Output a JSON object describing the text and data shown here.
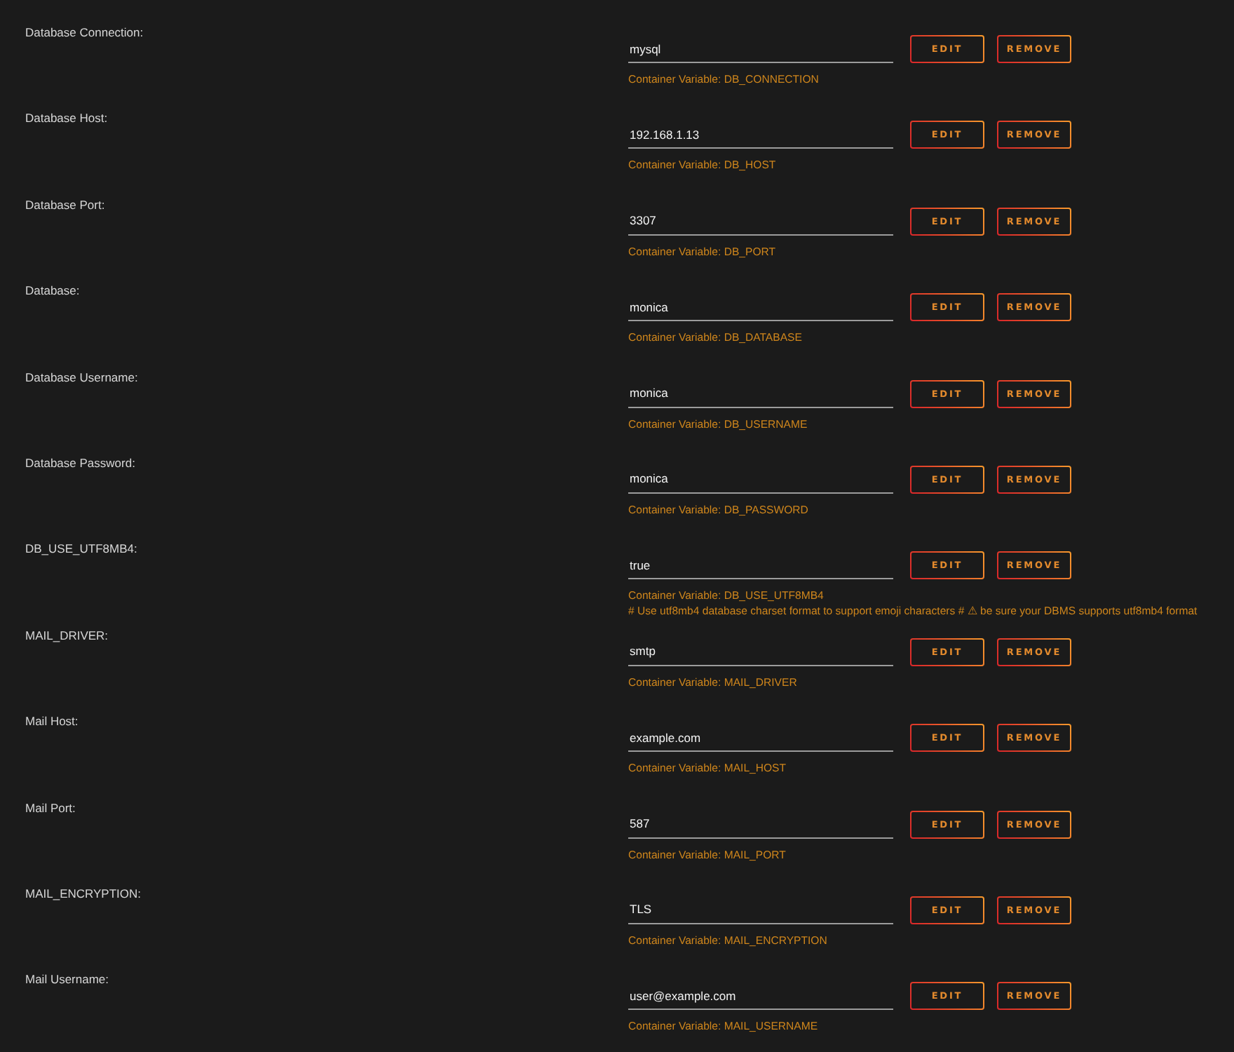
{
  "settings": [
    {
      "label": "Database Connection:",
      "value": "mysql",
      "variable": "Container Variable: DB_CONNECTION",
      "buttons": [
        "EDIT",
        "REMOVE"
      ]
    },
    {
      "label": "Database Host:",
      "value": "192.168.1.13",
      "variable": "Container Variable: DB_HOST",
      "buttons": [
        "EDIT",
        "REMOVE"
      ]
    },
    {
      "label": "Database Port:",
      "value": "3307",
      "variable": "Container Variable: DB_PORT",
      "buttons": [
        "EDIT",
        "REMOVE"
      ]
    },
    {
      "label": "Database:",
      "value": "monica",
      "variable": "Container Variable: DB_DATABASE",
      "buttons": [
        "EDIT",
        "REMOVE"
      ]
    },
    {
      "label": "Database Username:",
      "value": "monica",
      "variable": "Container Variable: DB_USERNAME",
      "buttons": [
        "EDIT",
        "REMOVE"
      ]
    },
    {
      "label": "Database Password:",
      "value": "monica",
      "variable": "Container Variable: DB_PASSWORD",
      "buttons": [
        "EDIT",
        "REMOVE"
      ]
    },
    {
      "label": "DB_USE_UTF8MB4:",
      "value": "true",
      "variable": "Container Variable: DB_USE_UTF8MB4",
      "note": "# Use utf8mb4 database charset format to support emoji characters # ⚠ be sure your DBMS supports utf8mb4 format",
      "buttons": [
        "EDIT",
        "REMOVE"
      ]
    },
    {
      "label": "MAIL_DRIVER:",
      "value": "smtp",
      "variable": "Container Variable: MAIL_DRIVER",
      "buttons": [
        "EDIT",
        "REMOVE"
      ]
    },
    {
      "label": "Mail Host:",
      "value": "example.com",
      "variable": "Container Variable: MAIL_HOST",
      "buttons": [
        "EDIT",
        "REMOVE"
      ]
    },
    {
      "label": "Mail Port:",
      "value": "587",
      "variable": "Container Variable: MAIL_PORT",
      "buttons": [
        "EDIT",
        "REMOVE"
      ]
    },
    {
      "label": "MAIL_ENCRYPTION:",
      "value": "TLS",
      "variable": "Container Variable: MAIL_ENCRYPTION",
      "buttons": [
        "EDIT",
        "REMOVE"
      ]
    },
    {
      "label": "Mail Username:",
      "value": "user@example.com",
      "variable": "Container Variable: MAIL_USERNAME",
      "buttons": [
        "EDIT",
        "REMOVE"
      ]
    }
  ]
}
